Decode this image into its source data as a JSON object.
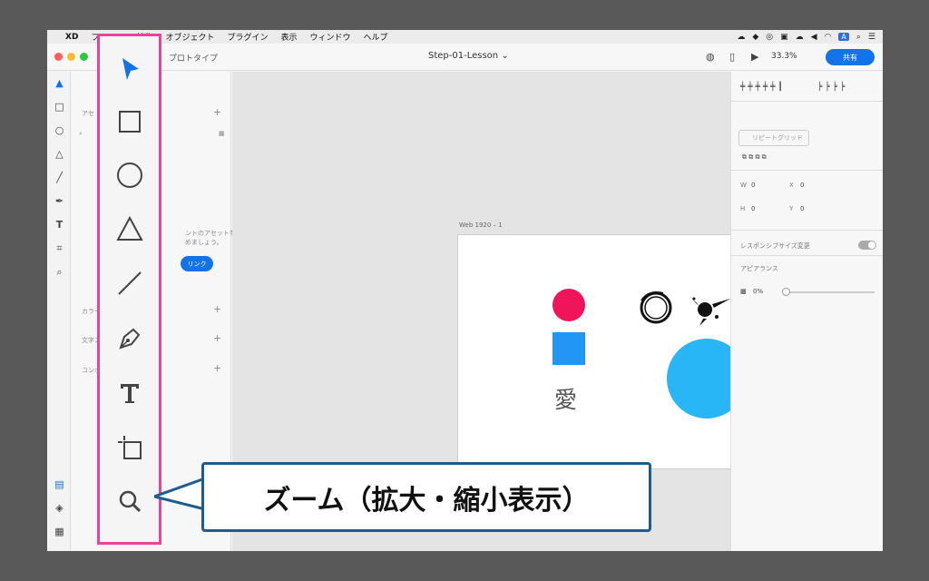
{
  "menubar": {
    "app": "XD",
    "items": [
      "ファイル",
      "編集",
      "オブジェクト",
      "プラグイン",
      "表示",
      "ウィンドウ",
      "ヘルプ"
    ],
    "status_badge": "A"
  },
  "toolbar": {
    "prototype_tab": "プロトタイプ",
    "document_title": "Step-01-Lesson",
    "zoom": "33.3%",
    "share_label": "共有"
  },
  "assets": {
    "search_label": "アセ",
    "empty_text_1": "ントのアセットを",
    "empty_text_2": "めましょう。",
    "link_label": "リンク",
    "colors_label": "カラー",
    "text_label": "文字ス",
    "components_label": "コンポ"
  },
  "canvas": {
    "artboard_name": "Web 1920 – 1",
    "kanji": "愛"
  },
  "inspector": {
    "repeat_grid": "リピートグリッド",
    "w_label": "W",
    "w_value": "0",
    "h_label": "H",
    "h_value": "0",
    "x_label": "X",
    "x_value": "0",
    "y_label": "Y",
    "y_value": "0",
    "responsive_label": "レスポンシブサイズ変更",
    "appearance_label": "アピアランス",
    "opacity_value": "0%"
  },
  "callout": {
    "text": "ズーム（拡大・縮小表示）"
  },
  "colors": {
    "accent": "#1473e6",
    "highlight": "#e8449a",
    "callout_border": "#1e5b8f",
    "circle_red": "#f0145a",
    "square_blue": "#2196f3",
    "circle_cyan": "#29b6f6"
  }
}
